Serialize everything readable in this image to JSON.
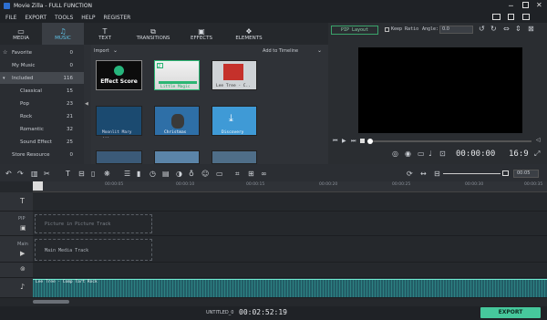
{
  "title": {
    "app": "Movie Zilla - FULL FUNCTION"
  },
  "menu": [
    "FILE",
    "EXPORT",
    "TOOLS",
    "HELP",
    "REGISTER"
  ],
  "tabs": [
    {
      "label": "MEDIA",
      "icon": "folder-icon"
    },
    {
      "label": "MUSIC",
      "icon": "music-note-icon"
    },
    {
      "label": "TEXT",
      "icon": "text-icon"
    },
    {
      "label": "TRANSITIONS",
      "icon": "transitions-icon"
    },
    {
      "label": "EFFECTS",
      "icon": "effects-icon"
    },
    {
      "label": "ELEMENTS",
      "icon": "elements-icon"
    }
  ],
  "categories": [
    {
      "label": "Favorite",
      "count": "0"
    },
    {
      "label": "My Music",
      "count": "0"
    },
    {
      "label": "Included",
      "count": "116"
    },
    {
      "label": "Classical",
      "count": "15"
    },
    {
      "label": "Pop",
      "count": "23"
    },
    {
      "label": "Rock",
      "count": "21"
    },
    {
      "label": "Romantic",
      "count": "32"
    },
    {
      "label": "Sound Effect",
      "count": "25"
    },
    {
      "label": "Store Resource",
      "count": "0"
    }
  ],
  "media": {
    "import": "Import",
    "add_timeline": "Add to Timeline",
    "effect_score": "Effect Score",
    "items": [
      "Little Magic",
      "Lee Tree - C..",
      "Moonlit Mary ...",
      "Christmas",
      "Discovery"
    ]
  },
  "preview": {
    "pip": "PIP Layout",
    "keep_ratio": "Keep Ratio",
    "angle_label": "Angle:",
    "angle": "0.0",
    "timecode": "00:00:00",
    "ratio": "16:9"
  },
  "timeline": {
    "time_value": "00:05",
    "ruler": [
      "00:00:00",
      "00:00:05",
      "00:00:10",
      "00:00:15",
      "00:00:20",
      "00:00:25",
      "00:00:30",
      "00:00:35",
      "00:00:40",
      "00:00:45",
      "00:00:50"
    ],
    "pip_track": "Picture in Picture Track",
    "main_track": "Main Media Track",
    "audio_clip": "Lee Tree - Comp Tart Rock",
    "pip_label": "PIP",
    "main_label": "Main"
  },
  "footer": {
    "project": "UNTITLED_0",
    "timecode": "00:02:52:19",
    "export": "EXPORT"
  }
}
